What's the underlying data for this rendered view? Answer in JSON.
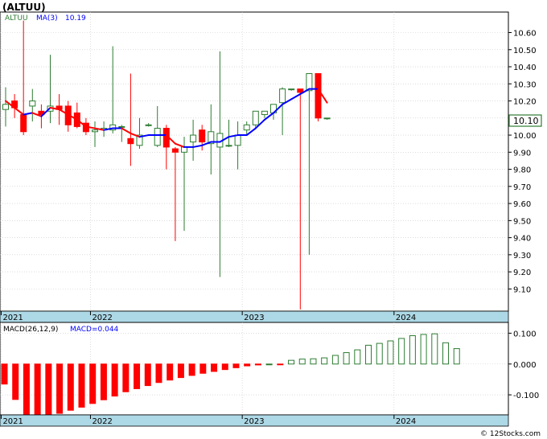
{
  "title": "(ALTUU)",
  "watermark": "© 12Stocks.com",
  "colors": {
    "up": "#2e7d32",
    "down": "#ff0000",
    "ma_up": "#0000ff",
    "ma_down": "#ff0000",
    "axis_strip": "#add8e6",
    "macd_neg": "#ff0000",
    "macd_pos": "#2e7d32",
    "grid": "#c8c8c8",
    "last_price_box": "#2e7d32"
  },
  "chart_data": [
    {
      "type": "candlestick",
      "legend": {
        "symbol": "ALTUU",
        "ma_label": "MA(3)",
        "ma_value": "10.19"
      },
      "last_price_label": "10.10",
      "last_price": 10.1,
      "ylim": [
        8.97,
        10.72
      ],
      "y_ticks": [
        9.1,
        9.2,
        9.3,
        9.4,
        9.5,
        9.6,
        9.7,
        9.8,
        9.9,
        10.0,
        10.1,
        10.2,
        10.3,
        10.4,
        10.5,
        10.6
      ],
      "y_tick_labels": [
        "9.10",
        "9.20",
        "9.30",
        "9.40",
        "9.50",
        "9.60",
        "9.70",
        "9.80",
        "9.90",
        "10.00",
        "10.10",
        "10.20",
        "10.30",
        "10.40",
        "10.50",
        "10.60"
      ],
      "x_labels": [
        "2021",
        "2022",
        "2023",
        "2024"
      ],
      "x_label_index": [
        0,
        10,
        27,
        44
      ],
      "grid": true,
      "candles": [
        {
          "o": 10.15,
          "h": 10.28,
          "l": 10.05,
          "c": 10.18
        },
        {
          "o": 10.2,
          "h": 10.24,
          "l": 10.1,
          "c": 10.16
        },
        {
          "o": 10.12,
          "h": 10.67,
          "l": 10.0,
          "c": 10.02
        },
        {
          "o": 10.17,
          "h": 10.27,
          "l": 10.08,
          "c": 10.2
        },
        {
          "o": 10.14,
          "h": 10.18,
          "l": 10.04,
          "c": 10.12
        },
        {
          "o": 10.14,
          "h": 10.47,
          "l": 10.07,
          "c": 10.17
        },
        {
          "o": 10.17,
          "h": 10.24,
          "l": 10.06,
          "c": 10.15
        },
        {
          "o": 10.17,
          "h": 10.2,
          "l": 10.02,
          "c": 10.06
        },
        {
          "o": 10.13,
          "h": 10.19,
          "l": 10.04,
          "c": 10.05
        },
        {
          "o": 10.07,
          "h": 10.1,
          "l": 10.0,
          "c": 10.02
        },
        {
          "o": 10.02,
          "h": 10.08,
          "l": 9.93,
          "c": 10.03
        },
        {
          "o": 10.03,
          "h": 10.08,
          "l": 9.99,
          "c": 10.04
        },
        {
          "o": 10.03,
          "h": 10.52,
          "l": 10.01,
          "c": 10.06
        },
        {
          "o": 10.05,
          "h": 10.06,
          "l": 9.96,
          "c": 10.05
        },
        {
          "o": 9.98,
          "h": 10.36,
          "l": 9.82,
          "c": 9.95
        },
        {
          "o": 9.94,
          "h": 10.1,
          "l": 9.92,
          "c": 10.0
        },
        {
          "o": 10.06,
          "h": 10.07,
          "l": 10.05,
          "c": 10.06
        },
        {
          "o": 9.94,
          "h": 10.17,
          "l": 9.93,
          "c": 10.04
        },
        {
          "o": 10.04,
          "h": 10.06,
          "l": 9.8,
          "c": 9.93
        },
        {
          "o": 9.92,
          "h": 9.93,
          "l": 9.38,
          "c": 9.9
        },
        {
          "o": 9.9,
          "h": 9.99,
          "l": 9.44,
          "c": 9.93
        },
        {
          "o": 9.96,
          "h": 10.09,
          "l": 9.85,
          "c": 10.0
        },
        {
          "o": 10.03,
          "h": 10.06,
          "l": 9.91,
          "c": 9.96
        },
        {
          "o": 9.95,
          "h": 10.18,
          "l": 9.77,
          "c": 10.02
        },
        {
          "o": 9.93,
          "h": 10.49,
          "l": 9.17,
          "c": 10.01
        },
        {
          "o": 9.94,
          "h": 10.09,
          "l": 9.93,
          "c": 9.94
        },
        {
          "o": 9.94,
          "h": 10.08,
          "l": 9.8,
          "c": 10.0
        },
        {
          "o": 10.03,
          "h": 10.08,
          "l": 10.0,
          "c": 10.06
        },
        {
          "o": 10.06,
          "h": 10.14,
          "l": 10.04,
          "c": 10.14
        },
        {
          "o": 10.12,
          "h": 10.14,
          "l": 10.1,
          "c": 10.14
        },
        {
          "o": 10.13,
          "h": 10.18,
          "l": 10.09,
          "c": 10.18
        },
        {
          "o": 10.19,
          "h": 10.28,
          "l": 10.0,
          "c": 10.27
        },
        {
          "o": 10.27,
          "h": 10.27,
          "l": 10.26,
          "c": 10.27
        },
        {
          "o": 10.27,
          "h": 10.27,
          "l": 8.98,
          "c": 10.25
        },
        {
          "o": 10.26,
          "h": 10.36,
          "l": 9.3,
          "c": 10.36
        },
        {
          "o": 10.36,
          "h": 10.36,
          "l": 10.08,
          "c": 10.1
        },
        {
          "o": 10.1,
          "h": 10.1,
          "l": 10.09,
          "c": 10.1
        }
      ],
      "ma": [
        10.2,
        10.16,
        10.12,
        10.13,
        10.11,
        10.16,
        10.15,
        10.12,
        10.09,
        10.05,
        10.04,
        10.03,
        10.04,
        10.04,
        10.01,
        9.99,
        10.0,
        10.0,
        10.0,
        9.95,
        9.93,
        9.93,
        9.94,
        9.96,
        9.96,
        9.99,
        10.0,
        10.0,
        10.04,
        10.09,
        10.13,
        10.18,
        10.21,
        10.24,
        10.27,
        10.27,
        10.19
      ]
    },
    {
      "type": "bar",
      "title": "MACD(26,12,9)",
      "value_label": "MACD=0.044",
      "ylim": [
        -0.165,
        0.135
      ],
      "y_ticks": [
        0.1,
        0.0,
        -0.1
      ],
      "y_tick_labels": [
        "0.100",
        "0.000",
        "-0.100"
      ],
      "x_labels": [
        "2021",
        "2022",
        "2023",
        "2024"
      ],
      "x_label_index": [
        0,
        10,
        27,
        44
      ],
      "values": [
        -0.065,
        -0.115,
        -0.165,
        -0.165,
        -0.165,
        -0.16,
        -0.15,
        -0.14,
        -0.128,
        -0.116,
        -0.104,
        -0.09,
        -0.08,
        -0.07,
        -0.06,
        -0.052,
        -0.044,
        -0.037,
        -0.03,
        -0.024,
        -0.018,
        -0.012,
        -0.006,
        -0.003,
        0.0,
        -0.001,
        0.012,
        0.016,
        0.017,
        0.02,
        0.028,
        0.037,
        0.046,
        0.061,
        0.067,
        0.075,
        0.083,
        0.092,
        0.096,
        0.098,
        0.069,
        0.05
      ]
    }
  ]
}
